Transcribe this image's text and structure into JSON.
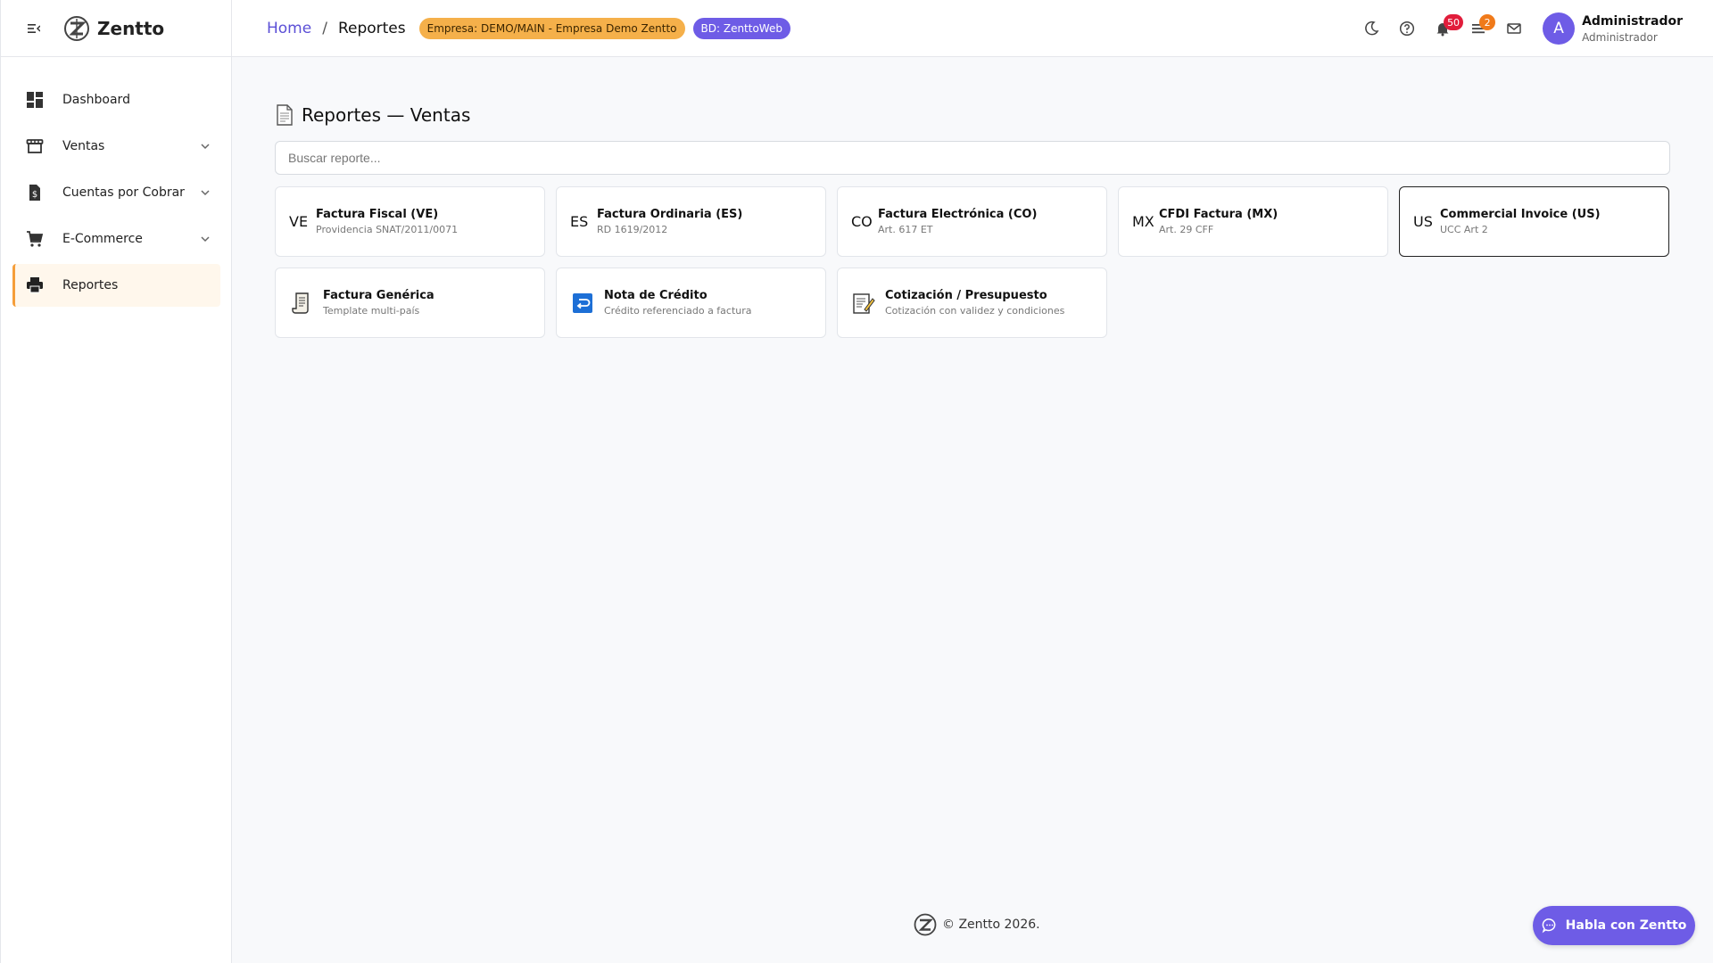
{
  "app": {
    "brand": "Zentto"
  },
  "sidebar": {
    "items": [
      {
        "label": "Dashboard",
        "icon": "dashboard-icon",
        "expandable": false
      },
      {
        "label": "Ventas",
        "icon": "store-icon",
        "expandable": true
      },
      {
        "label": "Cuentas por Cobrar",
        "icon": "receivable-icon",
        "expandable": true
      },
      {
        "label": "E-Commerce",
        "icon": "cart-icon",
        "expandable": true
      },
      {
        "label": "Reportes",
        "icon": "printer-icon",
        "expandable": false,
        "active": true
      }
    ]
  },
  "header": {
    "breadcrumb": {
      "home": "Home",
      "separator": "/",
      "current": "Reportes"
    },
    "empresa_chip": "Empresa: DEMO/MAIN - Empresa Demo Zentto",
    "bd_chip": "BD: ZenttoWeb",
    "notifications_count": "50",
    "tasks_count": "2",
    "user": {
      "initial": "A",
      "name": "Administrador",
      "role": "Administrador"
    }
  },
  "main": {
    "title": "Reportes — Ventas",
    "search_placeholder": "Buscar reporte...",
    "cards": [
      {
        "code": "VE",
        "title": "Factura Fiscal (VE)",
        "subtitle": "Providencia SNAT/2011/0071"
      },
      {
        "code": "ES",
        "title": "Factura Ordinaria (ES)",
        "subtitle": "RD 1619/2012"
      },
      {
        "code": "CO",
        "title": "Factura Electrónica (CO)",
        "subtitle": "Art. 617 ET"
      },
      {
        "code": "MX",
        "title": "CFDI Factura (MX)",
        "subtitle": "Art. 29 CFF"
      },
      {
        "code": "US",
        "title": "Commercial Invoice (US)",
        "subtitle": "UCC Art 2",
        "selected": true
      },
      {
        "icon": "scroll-icon",
        "title": "Factura Genérica",
        "subtitle": "Template multi-país"
      },
      {
        "icon": "return-arrow-icon",
        "title": "Nota de Crédito",
        "subtitle": "Crédito referenciado a factura"
      },
      {
        "icon": "memo-icon",
        "title": "Cotización / Presupuesto",
        "subtitle": "Cotización con validez y condiciones"
      }
    ]
  },
  "footer": {
    "text": "© Zentto 2026."
  },
  "chat": {
    "label": "Habla con Zentto"
  },
  "colors": {
    "accent": "#6e5ce6",
    "empresa_chip": "#f5b04a",
    "active_bar": "#f59e3a",
    "badge_red": "#e11d3b",
    "badge_orange": "#f07a1a"
  }
}
